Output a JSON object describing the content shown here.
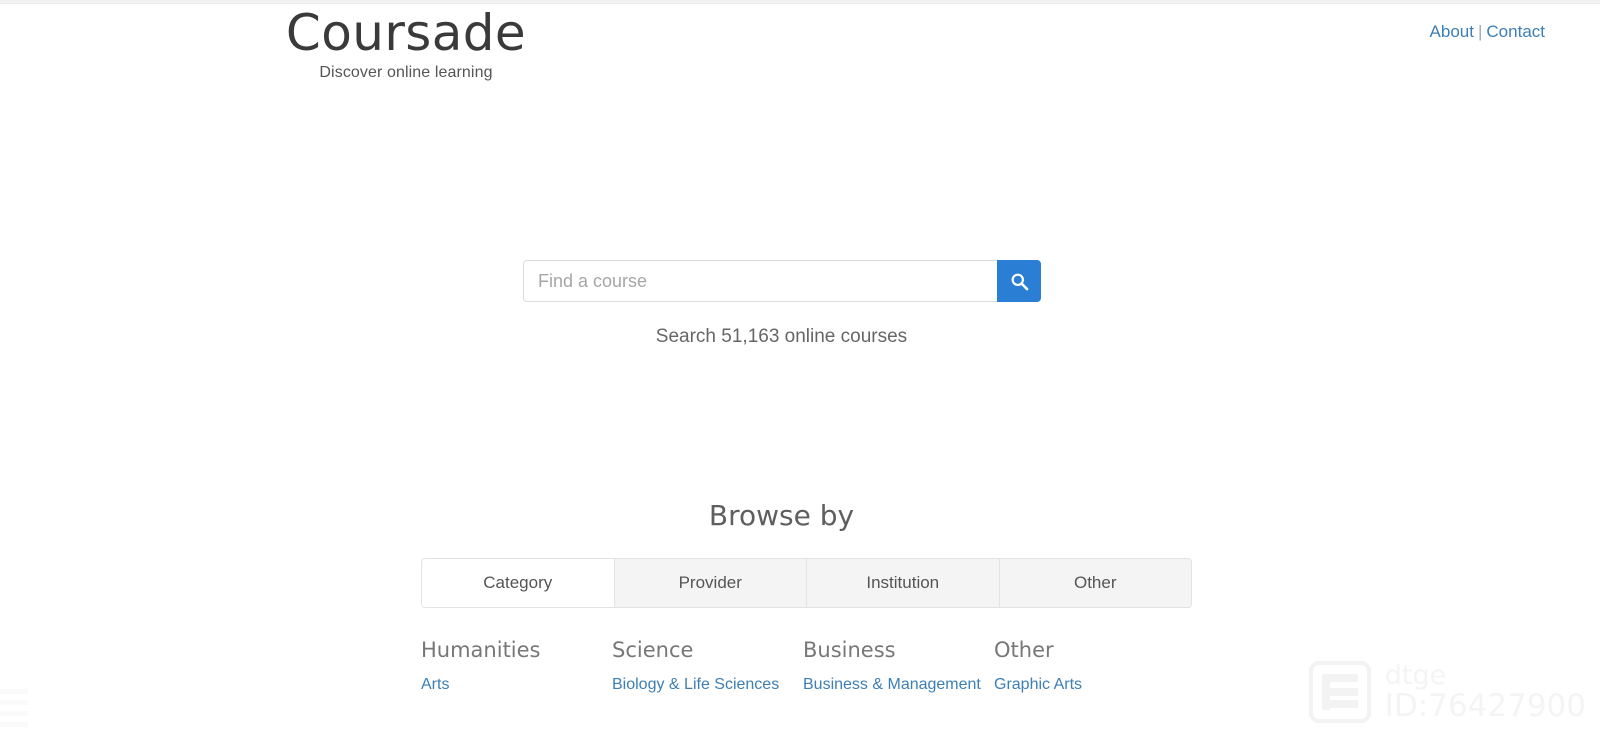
{
  "header": {
    "brand_title": "Coursade",
    "brand_tagline": "Discover online learning",
    "nav": {
      "about_label": "About",
      "separator": "|",
      "contact_label": "Contact"
    }
  },
  "search": {
    "placeholder": "Find a course",
    "value": "",
    "button_icon": "search-icon",
    "subtitle": "Search 51,163 online courses",
    "accent_color": "#2a7fd4"
  },
  "browse": {
    "title": "Browse by",
    "tabs": [
      {
        "label": "Category",
        "active": true
      },
      {
        "label": "Provider",
        "active": false
      },
      {
        "label": "Institution",
        "active": false
      },
      {
        "label": "Other",
        "active": false
      }
    ],
    "columns": [
      {
        "heading": "Humanities",
        "links": [
          "Arts"
        ]
      },
      {
        "heading": "Science",
        "links": [
          "Biology & Life Sciences"
        ]
      },
      {
        "heading": "Business",
        "links": [
          "Business & Management"
        ]
      },
      {
        "heading": "Other",
        "links": [
          "Graphic Arts"
        ]
      }
    ]
  },
  "watermark": {
    "name": "dtge",
    "id": "ID:76427900"
  },
  "colors": {
    "link": "#3d7fb5",
    "accent": "#2a7fd4",
    "muted_text": "#777777",
    "tab_inactive_bg": "#f4f4f4"
  }
}
